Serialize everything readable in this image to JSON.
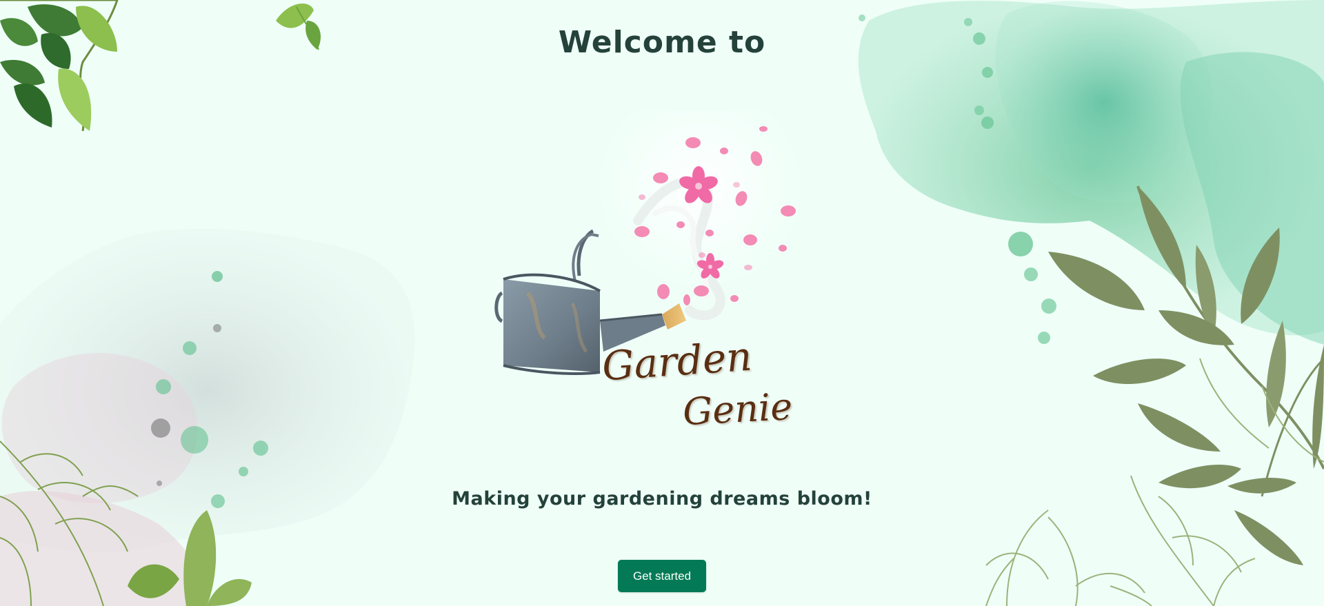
{
  "hero": {
    "heading": "Welcome to",
    "logo": {
      "line1": "Garden",
      "line2": "Genie",
      "icon": "watering-can-icon"
    },
    "tagline": "Making your gardening dreams bloom!",
    "cta_label": "Get started"
  },
  "colors": {
    "background": "#effff8",
    "heading": "#24423a",
    "logo_text": "#5a2e12",
    "button": "#037a55",
    "petal": "#f38bb4",
    "watercolor_green": "#69c796",
    "watercolor_grey": "#d6e3e0",
    "leaf_olive": "#7e9062"
  }
}
